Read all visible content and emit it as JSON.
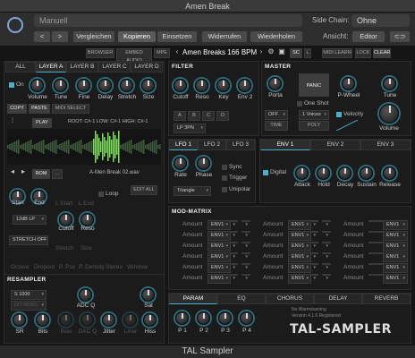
{
  "window": {
    "title": "Amen Break",
    "footer": "TAL Sampler"
  },
  "host": {
    "preset": "Manuell",
    "sidechain_label": "Side Chain:",
    "sidechain_value": "Ohne",
    "view_label": "Ansicht:",
    "view_value": "Editor",
    "compare": "Vergleichen",
    "copy": "Kopieren",
    "paste": "Einsetzen",
    "undo": "Widerrufen",
    "redo": "Wiederholen",
    "prev": "<",
    "next": ">"
  },
  "plugin_header": {
    "browser": "BROWSER",
    "embed": "EMBED AUDIO",
    "mpe": "MPE",
    "preset": "Amen Breaks 166 BPM",
    "sc": "SC",
    "l": "L",
    "midi_learn": "MIDI LEARN",
    "lock": "LOCK",
    "clear": "CLEAR"
  },
  "layer": {
    "tabs": [
      "ALL",
      "LAYER A",
      "LAYER B",
      "LAYER C",
      "LAYER D"
    ],
    "on": "On",
    "knobs": [
      "Volume",
      "Tune",
      "Fine",
      "Delay",
      "Stretch",
      "Size"
    ],
    "copy": "COPY",
    "paste": "PASTE",
    "midi_select": "MIDI SELECT",
    "play": "PLAY",
    "root_info": "ROOT: C#-1  LOW: C#-1  HIGH: C#-1",
    "rom": "ROM",
    "dots": "...",
    "sample": "A-Men Break 02.wav",
    "loop": "Loop",
    "edit_all": "EDIT ALL",
    "start": "Start",
    "end": "End",
    "lstart": "L Start",
    "lend": "L End",
    "filter_mode": "12dB LP",
    "cutoff": "Cutoff",
    "reso": "Reso",
    "stretch_mode": "STRETCH OFF",
    "stretch": "Stretch",
    "size": "Size",
    "extra": [
      "Octave",
      "Dropout",
      "P. Pos",
      "P. Density",
      "Stereo",
      "Window"
    ]
  },
  "filter": {
    "title": "FILTER",
    "knobs": [
      "Cutoff",
      "Reso",
      "Key",
      "Env 2"
    ],
    "abcd": [
      "A",
      "B",
      "C",
      "D"
    ],
    "mode": "LP 3PN"
  },
  "master": {
    "title": "MASTER",
    "porta": "Porta",
    "panic": "PANIC",
    "pwheel": "P-Wheel",
    "tune": "Tune",
    "one_shot": "One Shot",
    "off": "OFF",
    "voices": "1 Voices",
    "time": "TIME",
    "poly": "POLY",
    "velocity": "Velocity",
    "volume": "Volume"
  },
  "lfo": {
    "tabs": [
      "LFO 1",
      "LFO 2",
      "LFO 3"
    ],
    "rate": "Rate",
    "phase": "Phase",
    "sync": "Sync",
    "trigger": "Trigger",
    "unipolar": "Unipolar",
    "wave": "Triangle"
  },
  "env": {
    "tabs": [
      "ENV 1",
      "ENV 2",
      "ENV 3"
    ],
    "digital": "Digital",
    "knobs": [
      "Attack",
      "Hold",
      "Decay",
      "Sustain",
      "Release"
    ]
  },
  "modmatrix": {
    "title": "MOD-MATRIX",
    "amount": "Amount",
    "source": "ENV1"
  },
  "resampler": {
    "title": "RESAMPLER",
    "rate": "S 1000",
    "mode": "DIT-NDRS",
    "knobs": [
      "ADC Q",
      "Sat",
      "SR",
      "Bits",
      "Bias",
      "DAC Q",
      "Jitter",
      "Liner",
      "Hiss"
    ]
  },
  "fx": {
    "tabs": [
      "PARAM",
      "EQ",
      "CHORUS",
      "DELAY",
      "REVERB"
    ],
    "knobs": [
      "P 1",
      "P 2",
      "P 3",
      "P 4"
    ],
    "line1": "No Warmduening",
    "line2": "Version 4.1.6 Registered",
    "logo": "TAL-SAMPLER"
  },
  "colors": {
    "accent": "#4ab0c8",
    "waveform": "#7ee05a"
  }
}
